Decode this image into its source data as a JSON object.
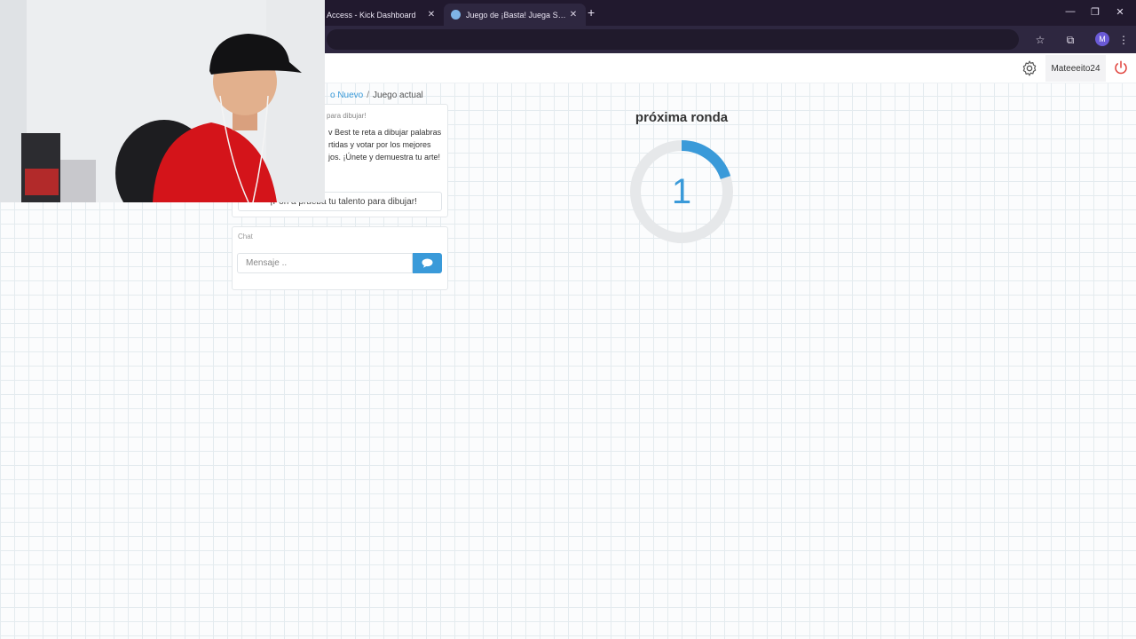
{
  "browser": {
    "tabs": [
      {
        "label": "Access - Kick Dashboard",
        "favicon_color": "#53fc18"
      },
      {
        "label": "Juego de ¡Basta! Juega Stop, Tu",
        "favicon_color": "#7fb4e6"
      }
    ],
    "profile_initial": "M",
    "icons": [
      "close-icon",
      "new-tab-icon",
      "minimize-icon",
      "restore-icon",
      "star-icon",
      "extensions-icon",
      "menu-icon"
    ]
  },
  "navbar": {
    "username": "Mateeeito24",
    "settings_icon": "gear-icon",
    "logout_icon": "power-icon"
  },
  "breadcrumb": {
    "link": "o Nuevo",
    "separator": "/",
    "current": "Juego actual"
  },
  "info_card": {
    "heading": "para dibujar!",
    "body": "v Best te reta a dibujar palabras rtidas y votar por los mejores jos. ¡Únete y demuestra tu arte!",
    "slogan": "¡Pon a prueba tu talento para dibujar!"
  },
  "chat": {
    "label": "Chat",
    "input_placeholder": "Mensaje ..",
    "send_icon": "chat-bubble-icon"
  },
  "round": {
    "title": "próxima ronda",
    "countdown": "1",
    "progress_fraction": 0.2,
    "accent_color": "#3a9ad9",
    "track_color": "#e6e8ea"
  }
}
